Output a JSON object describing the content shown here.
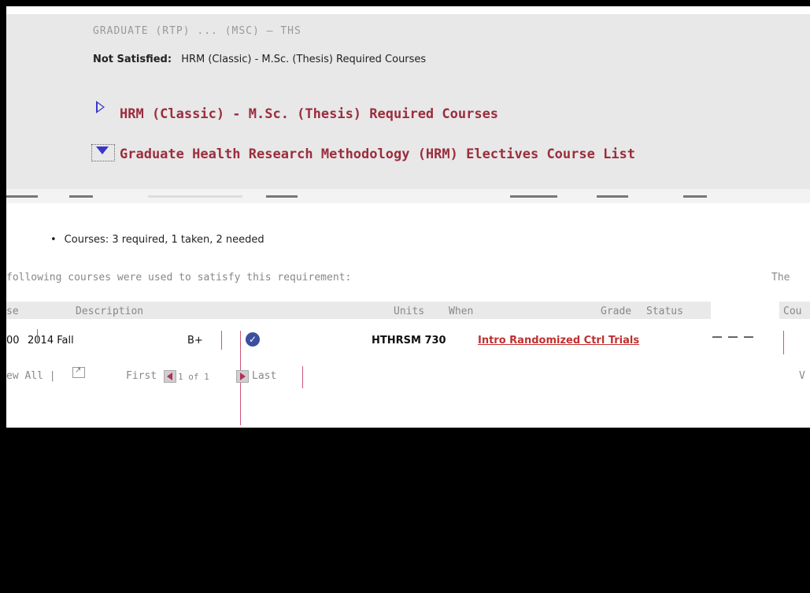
{
  "header": {
    "garbled_title": "GRADUATE (RTP) ... (MSC) — THS",
    "status_label": "Not Satisfied:",
    "status_value": "HRM (Classic) - M.Sc. (Thesis) Required Courses"
  },
  "links": {
    "required_courses": "HRM (Classic) - M.Sc. (Thesis) Required Courses",
    "electives_list": "Graduate Health Research Methodology (HRM) Electives Course List"
  },
  "requirement": {
    "bullet": "Courses: 3 required, 1 taken, 2 needed",
    "used_text": "following courses were used to satisfy this requirement:",
    "right_clip": "The"
  },
  "table": {
    "headers": [
      "se",
      "Description",
      "Units",
      "When",
      "Grade",
      "Status"
    ],
    "right_header": "Cou",
    "row": {
      "units": "00",
      "when": "2014 Fall",
      "grade": "B+",
      "course": "HTHRSM 730",
      "description": "Intro Randomized Ctrl Trials"
    }
  },
  "pager": {
    "view_all": "ew All |",
    "first": "First",
    "page": "1 of 1",
    "last": "Last",
    "right_clip": "V"
  },
  "colors": {
    "link_maroon": "#9b2d3d",
    "link_red": "#c03030",
    "accent_blue": "#3a36c9"
  }
}
